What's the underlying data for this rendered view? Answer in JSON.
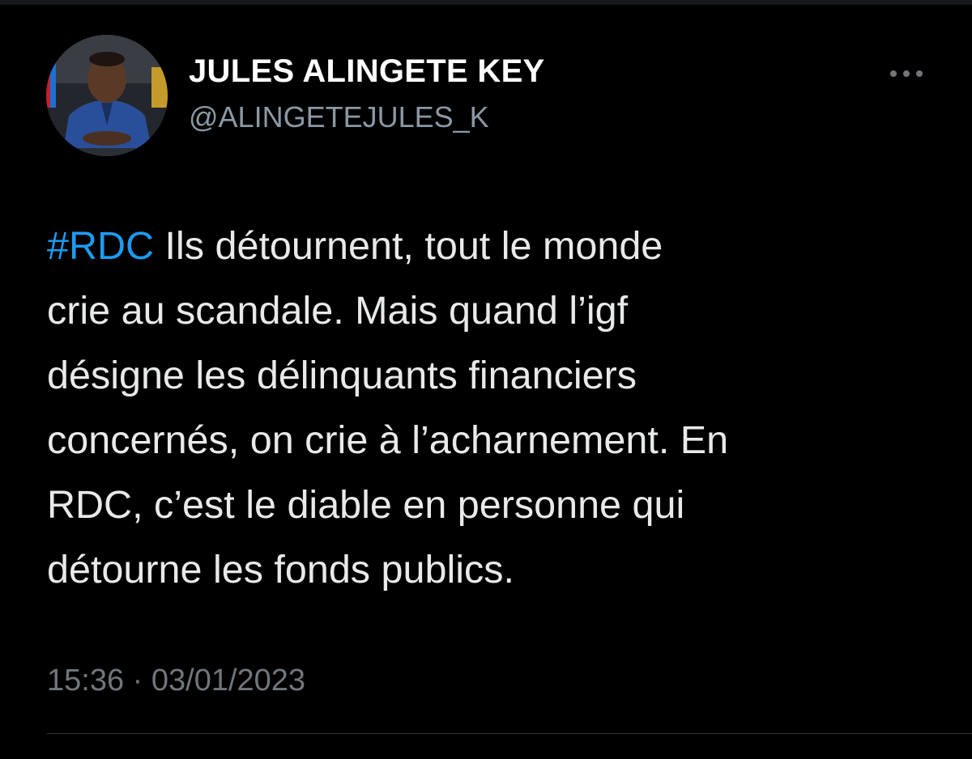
{
  "author": {
    "display_name": "JULES ALINGETE KEY",
    "handle": "@ALINGETEJULES_K",
    "avatar_icon": "profile-photo"
  },
  "menu": {
    "icon": "more-horizontal-icon"
  },
  "tweet": {
    "hashtag": "#RDC",
    "lines": [
      " Ils détournent, tout le monde",
      "crie au scandale. Mais quand l’igf",
      "désigne les délinquants financiers",
      "concernés, on crie à l’acharnement. En",
      "RDC, c’est le diable en personne qui",
      "détourne les fonds publics."
    ]
  },
  "meta": {
    "time": "15:36",
    "separator": " · ",
    "date": "03/01/2023"
  },
  "colors": {
    "background": "#000000",
    "text": "#e7e9ea",
    "secondary": "#8b98a5",
    "link": "#1d9bf0"
  }
}
